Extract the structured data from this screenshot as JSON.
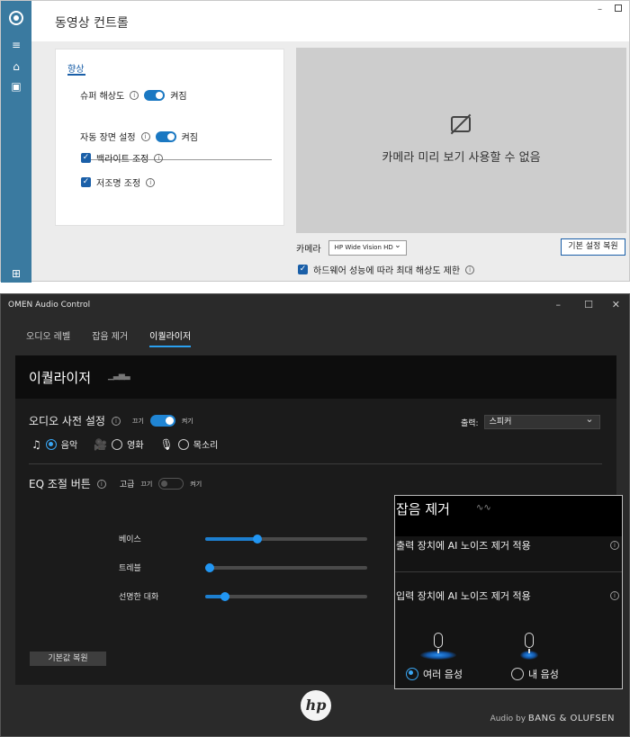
{
  "camera_app": {
    "title": "동영상 컨트롤",
    "section_tab": "향상",
    "super_res": {
      "label": "슈퍼 해상도",
      "state": "켜짐"
    },
    "auto_framing": {
      "label": "자동 장면 설정",
      "state": "켜짐"
    },
    "backlight": {
      "label": "백라이트 조정"
    },
    "low_light": {
      "label": "저조명 조정"
    },
    "preview_unavailable": "카메라 미리 보기 사용할 수 없음",
    "camera_label": "카메라",
    "camera_device": "HP Wide Vision HD",
    "reset_button": "기본 설정 복원",
    "hw_limit": "하드웨어 성능에 따라 최대 해상도 제한"
  },
  "omen": {
    "title": "OMEN Audio Control",
    "tabs": [
      {
        "label": "오디오 레벨"
      },
      {
        "label": "잡음 제거"
      },
      {
        "label": "이퀄라이저"
      }
    ],
    "eq": {
      "heading": "이퀄라이저",
      "preset_label": "오디오 사전 설정",
      "off": "끄기",
      "on": "켜기",
      "output_label": "출력:",
      "output_value": "스피커",
      "modes": [
        {
          "label": "음악"
        },
        {
          "label": "영화"
        },
        {
          "label": "목소리"
        }
      ],
      "eq_label": "EQ 조절 버튼",
      "advanced": "고급",
      "sliders": [
        {
          "label": "베이스",
          "value": 0.32
        },
        {
          "label": "트레블",
          "value": 0.02
        },
        {
          "label": "선명한 대화",
          "value": 0.12
        }
      ],
      "reset_button": "기본값 복원"
    },
    "noise": {
      "heading": "잡음 제거",
      "output_ai": "출력 장치에 AI 노이즈 제거 적용",
      "input_ai": "입력 장치에 AI 노이즈 제거 적용",
      "multi_voice": "여러 음성",
      "my_voice": "내 음성"
    },
    "footer": {
      "audio_by": "Audio by",
      "brand": "BANG & OLUFSEN",
      "logo": "hp"
    }
  }
}
